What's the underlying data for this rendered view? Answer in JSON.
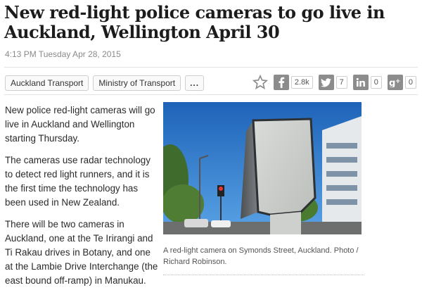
{
  "article": {
    "headline": "New red-light police cameras to go live in Auckland, Wellington April 30",
    "timestamp": "4:13 PM Tuesday Apr 28, 2015"
  },
  "tags": [
    "Auckland Transport",
    "Ministry of Transport",
    "..."
  ],
  "share": {
    "star_icon": "star-icon",
    "facebook": {
      "icon": "facebook-icon",
      "count": "2.8k"
    },
    "twitter": {
      "icon": "twitter-icon",
      "count": "7"
    },
    "linkedin": {
      "icon": "linkedin-icon",
      "count": "0"
    },
    "googleplus": {
      "icon": "googleplus-icon",
      "count": "0"
    }
  },
  "body": {
    "paragraphs": [
      "New police red-light cameras will go live in Auckland and Wellington starting Thursday.",
      "The cameras use radar technology to detect red light runners, and it is the first time the technology has been used in New Zealand.",
      "There will be two cameras in Auckland, one at the Te Irirangi and Ti Rakau drives in Botany, and one at the Lambie Drive Interchange (the east bound off-ramp) in Manukau."
    ]
  },
  "photo": {
    "caption": "A red-light camera on Symonds Street, Auckland. Photo / Richard Robinson."
  },
  "colors": {
    "icon_gray": "#8c8c8c",
    "sky": "#2f7fd0",
    "building": "#e6e9ec"
  }
}
